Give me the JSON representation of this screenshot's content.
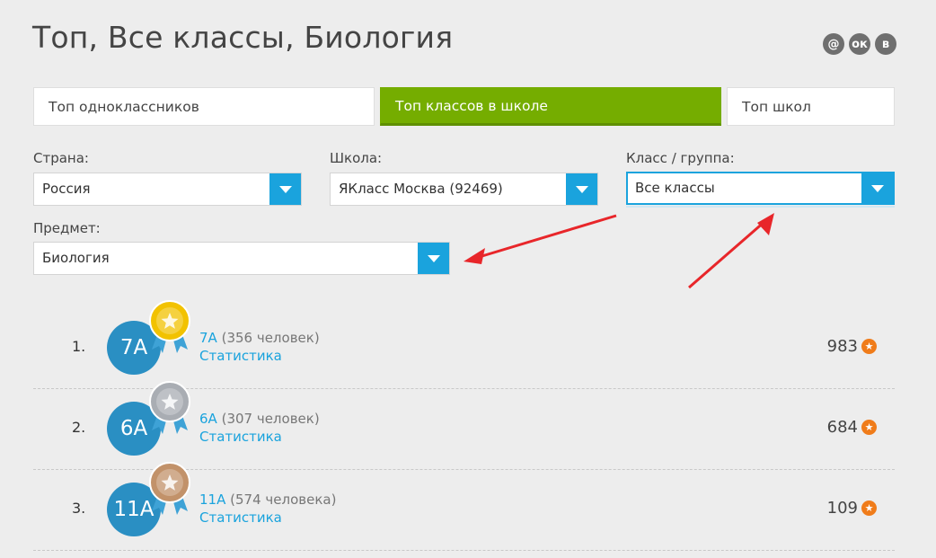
{
  "page": {
    "title": "Топ, Все классы, Биология"
  },
  "social": [
    {
      "name": "mail-icon",
      "glyph": "@"
    },
    {
      "name": "odnoklassniki-icon",
      "glyph": "ок"
    },
    {
      "name": "vk-icon",
      "glyph": "в"
    }
  ],
  "tabs": [
    {
      "label": "Топ одноклассников",
      "active": false
    },
    {
      "label": "Топ классов в школе",
      "active": true
    },
    {
      "label": "Топ школ",
      "active": false
    }
  ],
  "filters": {
    "country": {
      "label": "Страна:",
      "value": "Россия"
    },
    "school": {
      "label": "Школа:",
      "value": "ЯКласс Москва (92469)"
    },
    "group": {
      "label": "Класс / группа:",
      "value": "Все классы"
    },
    "subject": {
      "label": "Предмет:",
      "value": "Биология"
    }
  },
  "ranking": [
    {
      "rank": "1.",
      "class": "7А",
      "members": "(356 человек)",
      "stats": "Статистика",
      "score": "983",
      "medal": "gold",
      "medal_color": "#f2c200"
    },
    {
      "rank": "2.",
      "class": "6А",
      "members": "(307 человек)",
      "stats": "Статистика",
      "score": "684",
      "medal": "silver",
      "medal_color": "#a9adb3"
    },
    {
      "rank": "3.",
      "class": "11А",
      "members": "(574 человека)",
      "stats": "Статистика",
      "score": "109",
      "medal": "bronze",
      "medal_color": "#c2926a"
    }
  ],
  "colors": {
    "accent": "#1aa3dd",
    "active_tab": "#75ad00",
    "score_icon": "#f07c1a",
    "annotation_arrow": "#e8262a"
  }
}
